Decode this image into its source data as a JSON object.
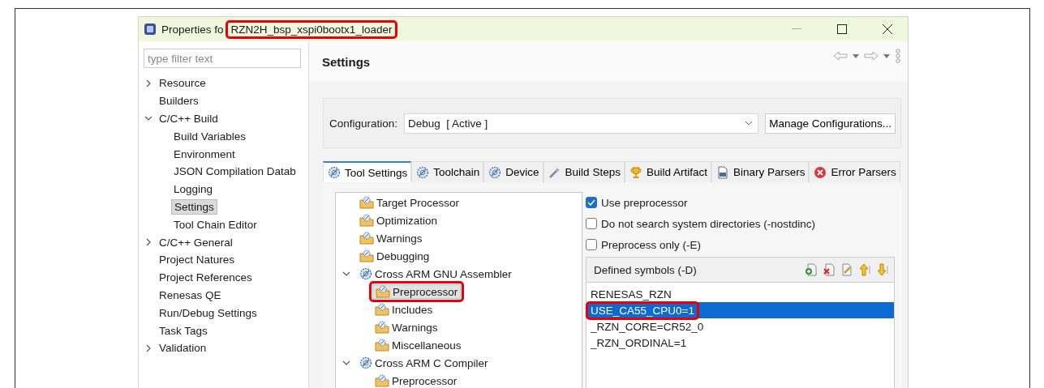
{
  "window": {
    "title_prefix": "Properties fo",
    "title": "RZN2H_bsp_xspi0bootx1_loader",
    "title_annotated": true
  },
  "sidebar": {
    "filter": {
      "placeholder": "type filter text"
    },
    "items": [
      {
        "label": "Resource",
        "expanded": false,
        "selected": false
      },
      {
        "label": "Builders",
        "selected": false
      },
      {
        "label": "C/C++ Build",
        "expanded": true,
        "selected": false,
        "children": [
          {
            "label": "Build Variables",
            "selected": false
          },
          {
            "label": "Environment",
            "selected": false
          },
          {
            "label": "JSON Compilation Datab",
            "selected": false
          },
          {
            "label": "Logging",
            "selected": false
          },
          {
            "label": "Settings",
            "selected": true
          },
          {
            "label": "Tool Chain Editor",
            "selected": false
          }
        ]
      },
      {
        "label": "C/C++ General",
        "expanded": false,
        "selected": false
      },
      {
        "label": "Project Natures",
        "selected": false
      },
      {
        "label": "Project References",
        "selected": false
      },
      {
        "label": "Renesas QE",
        "selected": false
      },
      {
        "label": "Run/Debug Settings",
        "selected": false
      },
      {
        "label": "Task Tags",
        "selected": false
      },
      {
        "label": "Validation",
        "expanded": false,
        "selected": false
      }
    ]
  },
  "page": {
    "title": "Settings",
    "configuration": {
      "label": "Configuration:",
      "value": "Debug  [ Active ]",
      "button": "Manage Configurations..."
    },
    "tabs": [
      {
        "label": "Tool Settings",
        "selected": true
      },
      {
        "label": "Toolchain",
        "selected": false
      },
      {
        "label": "Device",
        "selected": false
      },
      {
        "label": "Build Steps",
        "selected": false
      },
      {
        "label": "Build Artifact",
        "selected": false
      },
      {
        "label": "Binary Parsers",
        "selected": false
      },
      {
        "label": "Error Parsers",
        "selected": false
      }
    ],
    "tool_tree": [
      {
        "label": "Target Processor",
        "selected": false
      },
      {
        "label": "Optimization",
        "selected": false
      },
      {
        "label": "Warnings",
        "selected": false
      },
      {
        "label": "Debugging",
        "selected": false
      },
      {
        "label": "Cross ARM GNU Assembler",
        "expanded": true,
        "selected": false,
        "children": [
          {
            "label": "Preprocessor",
            "selected": true,
            "annotated": true
          },
          {
            "label": "Includes",
            "selected": false
          },
          {
            "label": "Warnings",
            "selected": false
          },
          {
            "label": "Miscellaneous",
            "selected": false
          }
        ]
      },
      {
        "label": "Cross ARM C Compiler",
        "expanded": true,
        "selected": false,
        "children": [
          {
            "label": "Preprocessor",
            "selected": false
          }
        ]
      }
    ],
    "options": [
      {
        "label": "Use preprocessor",
        "checked": true
      },
      {
        "label": "Do not search system directories (-nostdinc)",
        "checked": false
      },
      {
        "label": "Preprocess only (-E)",
        "checked": false
      }
    ],
    "symbols": {
      "title": "Defined symbols (-D)",
      "items": [
        {
          "label": "RENESAS_RZN",
          "selected": false
        },
        {
          "label": "USE_CA55_CPU0=1",
          "selected": true,
          "annotated": true
        },
        {
          "label": "_RZN_CORE=CR52_0",
          "selected": false
        },
        {
          "label": "_RZN_ORDINAL=1",
          "selected": false
        }
      ]
    }
  }
}
